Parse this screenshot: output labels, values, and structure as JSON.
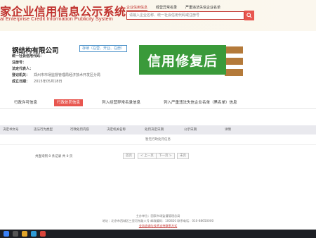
{
  "header": {
    "title": "家企业信用信息公示系统",
    "subtitle": "al Enterprise Credit Information Publicity System",
    "nav": [
      "企业信用信息",
      "经营异常名录",
      "严重违法失信企业名单"
    ],
    "search_placeholder": "请输入企业名称、统一社会信用代码或注册号"
  },
  "company": {
    "name": "钢结构有限公司",
    "status": "存续（在营、开业、在册）",
    "fields": [
      {
        "label": "统一社会信用代码：",
        "value": ""
      },
      {
        "label": "注册号：",
        "value": ""
      },
      {
        "label": "法定代表人：",
        "value": ""
      },
      {
        "label": "登记机关：",
        "value": "郑州市市场监督管理局经济技术开发区分局"
      },
      {
        "label": "成立日期：",
        "value": "2015年05月18日"
      }
    ],
    "side_buttons": [
      "",
      "",
      ""
    ]
  },
  "overlay": {
    "text": "信用修复后"
  },
  "tabs": [
    {
      "label": "行政许可信息",
      "active": false
    },
    {
      "label": "行政处罚信息",
      "active": true
    },
    {
      "label": "列入经营异常名录信息",
      "active": false
    },
    {
      "label": "列入严重违法失信企业名单（黑名单）信息",
      "active": false
    }
  ],
  "table": {
    "columns": [
      "决定书文号",
      "违法行为类型",
      "行政处罚内容",
      "决定机关名称",
      "处罚决定日期",
      "公示日期",
      "详情"
    ],
    "empty_text": "暂无行政处罚信息"
  },
  "pager": {
    "info": "共查询到 0 条记录 共 0 页",
    "buttons": [
      "首页",
      "< 上一页",
      "下一页 >",
      "末页"
    ]
  },
  "footer": {
    "lines": [
      "主办单位：国家市场监督管理总局",
      "地址：北京市西城区三里河东路八号  邮政编码：100820  联系电话：010-88650000",
      "业务咨询与技术支持联系方式"
    ]
  },
  "colors": {
    "brand_red": "#c0302c",
    "overlay_green": "#3a9a3a",
    "tab_active": "#e8564f",
    "side_button": "#b47a3a"
  }
}
